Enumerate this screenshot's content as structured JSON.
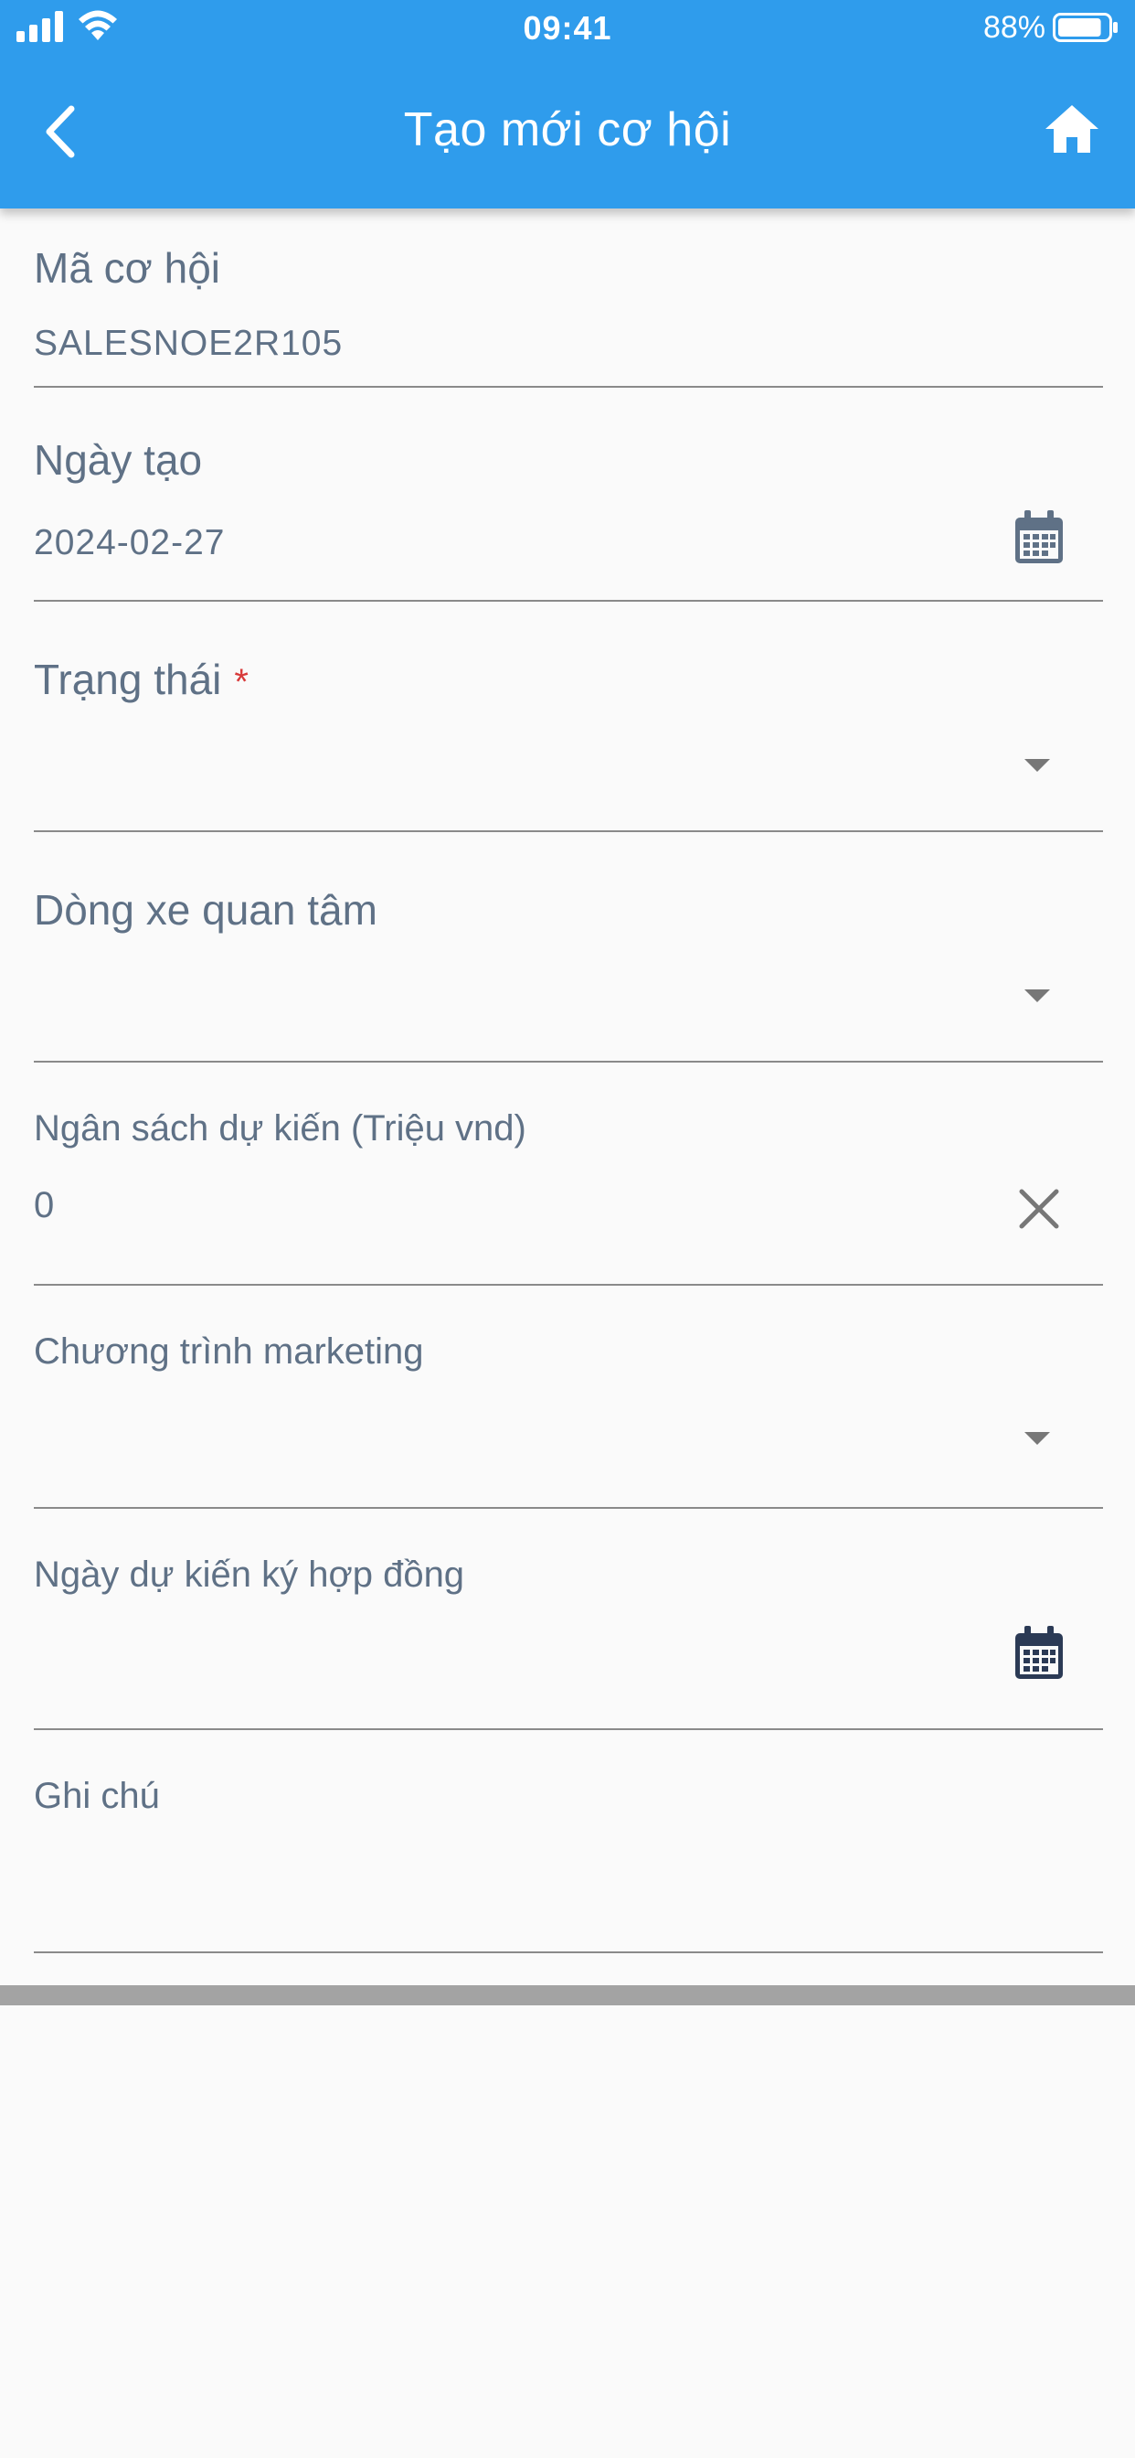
{
  "status_bar": {
    "time": "09:41",
    "battery_percent": "88%",
    "battery_level": 0.88,
    "icons": [
      "signal-icon",
      "wifi-icon",
      "battery-icon"
    ]
  },
  "header": {
    "title": "Tạo mới cơ hội",
    "background_color": "#2f9cec",
    "back_icon": "chevron-left-icon",
    "home_icon": "home-icon"
  },
  "form": {
    "opportunity_code": {
      "label": "Mã cơ hội",
      "value": "SALESNOE2R105"
    },
    "created_date": {
      "label": "Ngày tạo",
      "value": "2024-02-27",
      "icon": "calendar-icon"
    },
    "status": {
      "label": "Trạng thái",
      "required_mark": "*",
      "value": "",
      "icon": "dropdown-arrow-icon"
    },
    "car_model": {
      "label": "Dòng xe quan tâm",
      "value": "",
      "icon": "dropdown-arrow-icon"
    },
    "budget": {
      "label": "Ngân sách dự kiến (Triệu vnd)",
      "value": "0",
      "icon": "clear-icon"
    },
    "marketing_program": {
      "label": "Chương trình marketing",
      "value": "",
      "icon": "dropdown-arrow-icon"
    },
    "expected_contract_date": {
      "label": "Ngày dự kiến ký hợp đồng",
      "value": "",
      "icon": "calendar-icon"
    },
    "notes": {
      "label": "Ghi chú",
      "value": ""
    }
  },
  "colors": {
    "label_text": "#5f7186",
    "required": "#d83a3a",
    "underline": "#8a8a8a",
    "calendar_inactive": "#5f7186",
    "calendar_active": "#2b3a55"
  }
}
